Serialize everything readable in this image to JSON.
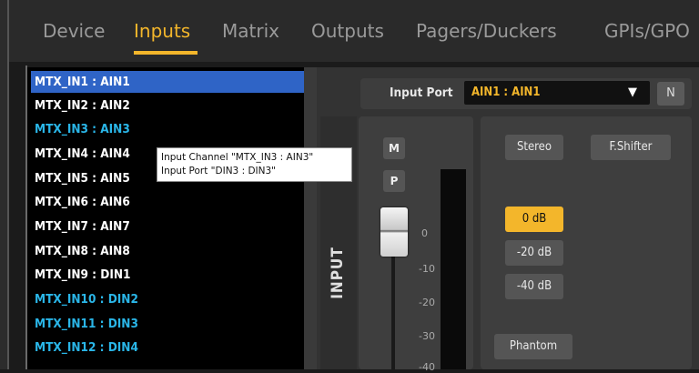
{
  "tabs": [
    {
      "label": "Device"
    },
    {
      "label": "Inputs",
      "active": true
    },
    {
      "label": "Matrix"
    },
    {
      "label": "Outputs"
    },
    {
      "label": "Pagers/Duckers"
    },
    {
      "label": "GPIs/GPO"
    }
  ],
  "channels": [
    {
      "label": "MTX_IN1 : AIN1",
      "selected": true
    },
    {
      "label": "MTX_IN2 : AIN2"
    },
    {
      "label": "MTX_IN3 : AIN3",
      "color": "cyan"
    },
    {
      "label": "MTX_IN4 : AIN4"
    },
    {
      "label": "MTX_IN5 : AIN5"
    },
    {
      "label": "MTX_IN6 : AIN6"
    },
    {
      "label": "MTX_IN7 : AIN7"
    },
    {
      "label": "MTX_IN8 : AIN8"
    },
    {
      "label": "MTX_IN9 : DIN1"
    },
    {
      "label": "MTX_IN10 : DIN2",
      "color": "cyan"
    },
    {
      "label": "MTX_IN11 : DIN3",
      "color": "cyan"
    },
    {
      "label": "MTX_IN12 : DIN4",
      "color": "cyan"
    }
  ],
  "tooltip": {
    "line1": "Input Channel \"MTX_IN3 : AIN3\"",
    "line2": "Input Port  \"DIN3 : DIN3\""
  },
  "input_port": {
    "label": "Input Port",
    "value": "AIN1 : AIN1",
    "n_button": "N"
  },
  "section_label": "INPUT",
  "fader": {
    "mute_label": "M",
    "p_label": "P",
    "scale": [
      "0",
      "-10",
      "-20",
      "-30",
      "-40"
    ]
  },
  "controls": {
    "stereo": "Stereo",
    "fshifter": "F.Shifter",
    "gain_0": "0 dB",
    "gain_20": "-20 dB",
    "gain_40": "-40 dB",
    "phantom": "Phantom",
    "active_gain": "0 dB"
  },
  "colors": {
    "accent": "#f3b62b",
    "selection": "#2f64c6",
    "cyan_text": "#2ab6e8"
  }
}
